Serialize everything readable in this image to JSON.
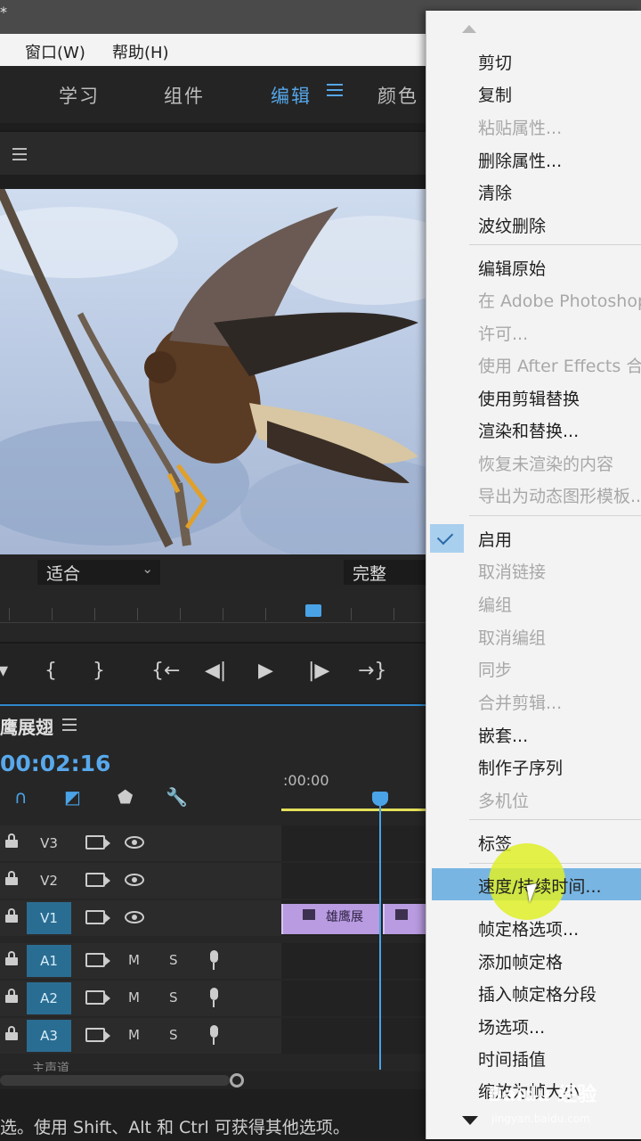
{
  "titlebar": {
    "marker": "*"
  },
  "menubar": {
    "window": "窗口(W)",
    "help": "帮助(H)"
  },
  "workspaces": [
    {
      "label": "学习",
      "active": false
    },
    {
      "label": "组件",
      "active": false
    },
    {
      "label": "编辑",
      "active": true
    },
    {
      "label": "颜色",
      "active": false
    }
  ],
  "program_monitor": {
    "fit": "适合",
    "quality": "完整"
  },
  "transport": {
    "mark_in": "{",
    "mark_out": "}",
    "go_to_in": "{←",
    "step_back": "◀|",
    "play": "▶",
    "step_forward": "|▶",
    "go_to_out": "→}"
  },
  "timeline": {
    "sequence_name": "鹰展翅",
    "timecode": "00:02:16",
    "ruler_time": ":00:00",
    "video_tracks": [
      {
        "label": "V3",
        "targeted": false
      },
      {
        "label": "V2",
        "targeted": false
      },
      {
        "label": "V1",
        "targeted": true
      }
    ],
    "audio_tracks": [
      {
        "label": "A1",
        "m": "M",
        "s": "S"
      },
      {
        "label": "A2",
        "m": "M",
        "s": "S"
      },
      {
        "label": "A3",
        "m": "M",
        "s": "S"
      }
    ],
    "clip_label": "雄鹰展",
    "master_label": "主声道"
  },
  "statusbar": {
    "text": "选。使用 Shift、Alt 和 Ctrl 可获得其他选项。"
  },
  "context_menu": {
    "items": [
      {
        "label": "剪切",
        "disabled": false
      },
      {
        "label": "复制",
        "disabled": false
      },
      {
        "label": "粘贴属性...",
        "disabled": true
      },
      {
        "label": "删除属性...",
        "disabled": false
      },
      {
        "label": "清除",
        "disabled": false
      },
      {
        "label": "波纹删除",
        "disabled": false
      },
      {
        "label": "编辑原始",
        "disabled": false
      },
      {
        "label": "在 Adobe Photoshop",
        "disabled": true
      },
      {
        "label": "许可...",
        "disabled": true
      },
      {
        "label": "使用 After Effects 合",
        "disabled": true
      },
      {
        "label": "使用剪辑替换",
        "disabled": false
      },
      {
        "label": "渲染和替换...",
        "disabled": false
      },
      {
        "label": "恢复未渲染的内容",
        "disabled": true
      },
      {
        "label": "导出为动态图形模板...",
        "disabled": true
      },
      {
        "label": "启用",
        "disabled": false,
        "checked": true
      },
      {
        "label": "取消链接",
        "disabled": true
      },
      {
        "label": "编组",
        "disabled": true
      },
      {
        "label": "取消编组",
        "disabled": true
      },
      {
        "label": "同步",
        "disabled": true
      },
      {
        "label": "合并剪辑...",
        "disabled": true
      },
      {
        "label": "嵌套...",
        "disabled": false
      },
      {
        "label": "制作子序列",
        "disabled": false
      },
      {
        "label": "多机位",
        "disabled": true
      },
      {
        "label": "标签",
        "disabled": false
      },
      {
        "label": "速度/持续时间...",
        "disabled": false,
        "highlighted": true
      },
      {
        "label": "帧定格选项...",
        "disabled": false
      },
      {
        "label": "添加帧定格",
        "disabled": false
      },
      {
        "label": "插入帧定格分段",
        "disabled": false
      },
      {
        "label": "场选项...",
        "disabled": false
      },
      {
        "label": "时间插值",
        "disabled": false
      },
      {
        "label": "缩放为帧大小",
        "disabled": false
      }
    ]
  },
  "watermark": {
    "brand": "Baidu 经验",
    "url": "jingyan.baidu.com"
  },
  "colors": {
    "accent_blue": "#55a6e8",
    "highlight": "#78b5e3",
    "clip_purple": "#b89be0",
    "timeline_in_out": "#e4e05a"
  }
}
